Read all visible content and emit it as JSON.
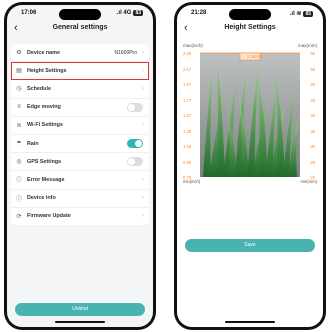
{
  "left": {
    "status": {
      "time": "17:06",
      "signal": ".ıl 4G",
      "battery": "83"
    },
    "title": "General settings",
    "back_icon": "chevron-left-icon",
    "items": [
      {
        "icon": "gear-icon",
        "glyph": "⚙",
        "label": "Device name",
        "value": "N1600Pro",
        "kind": "chevron"
      },
      {
        "icon": "height-icon",
        "glyph": "▤",
        "label": "Height Settings",
        "kind": "chevron",
        "selected": true
      },
      {
        "icon": "clock-icon",
        "glyph": "◷",
        "label": "Schedule",
        "kind": "chevron"
      },
      {
        "icon": "edge-icon",
        "glyph": "≡",
        "label": "Edge moving",
        "kind": "toggle",
        "on": false
      },
      {
        "icon": "wifi-icon",
        "glyph": "≋",
        "label": "Wi-Fi Settings",
        "kind": "chevron"
      },
      {
        "icon": "rain-icon",
        "glyph": "☂",
        "label": "Rain",
        "kind": "toggle",
        "on": true
      },
      {
        "icon": "gps-icon",
        "glyph": "◎",
        "label": "GPS Settings",
        "kind": "toggle",
        "on": false
      },
      {
        "icon": "error-icon",
        "glyph": "ⓘ",
        "label": "Error Message",
        "kind": "chevron"
      },
      {
        "icon": "info-icon",
        "glyph": "ⓘ",
        "label": "Device info",
        "kind": "chevron"
      },
      {
        "icon": "update-icon",
        "glyph": "⟳",
        "label": "Firmware Update",
        "kind": "chevron"
      }
    ],
    "unbind_label": "Unbind"
  },
  "right": {
    "status": {
      "time": "21:28",
      "signal": ".ıl ≋",
      "battery": "85"
    },
    "title": "Height Settings",
    "back_icon": "chevron-left-icon",
    "max_inch_label": "max(inch)",
    "max_mm_label": "max(mm)",
    "min_inch_label": "min(inch)",
    "min_mm_label": "min(mm)",
    "current_value": "2.36(60)",
    "inch_ticks": [
      "2.36",
      "2.17",
      "1.97",
      "1.77",
      "1.57",
      "1.38",
      "1.18",
      "0.98",
      "0.79"
    ],
    "mm_ticks": [
      "60",
      "55",
      "50",
      "45",
      "40",
      "35",
      "30",
      "25",
      "20"
    ],
    "save_label": "Save",
    "accent": "#ff8a2b",
    "button_color": "#49b3b1"
  }
}
